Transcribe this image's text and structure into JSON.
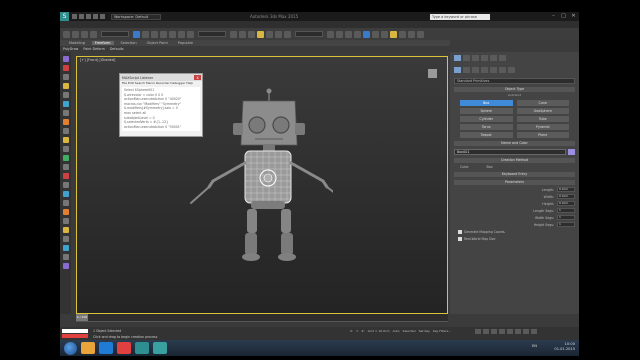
{
  "titlebar": {
    "logo": "S",
    "workspace": "Workspace: Default",
    "app_title": "Autodesk 3ds Max 2015",
    "search_placeholder": "Type a keyword or phrase",
    "min": "–",
    "max": "□",
    "close": "✕"
  },
  "ribbon": {
    "tabs": [
      "Modeling",
      "Freeform",
      "Selection",
      "Object Paint",
      "Populate"
    ],
    "active_tab": "Freeform",
    "subtabs": [
      "PolyDraw",
      "Paint Deform",
      "Defaults"
    ]
  },
  "viewport": {
    "label": "[+] [Front] [Shaded]"
  },
  "listener": {
    "title": "MAXScript Listener",
    "menu": "File  Edit  Search  Macro Recorder  Debugger  Help",
    "close": "x",
    "lines": [
      "Select $Sphere001",
      "$.wirecolor = color 0 0 0",
      "actionMan.executeAction 0 \"40020\"",
      "macros.run \"Modifiers\" \"Symmetry\"",
      "$.modifiers[#Symmetry].axis = 0",
      "max select all",
      "subobjectLevel = 0",
      "$.selectedVerts = #{1..12}",
      "actionMan.executeAction 0 \"50001\"",
      "modPanel.setCurrentObject $",
      "macros.run \"Edit Poly\" \"Attach\"",
      "select $Box001"
    ]
  },
  "command_panel": {
    "category": "Standard Primitives",
    "object_type": "Object Type",
    "autogrid": "AutoGrid",
    "buttons": [
      "Box",
      "Cone",
      "Sphere",
      "GeoSphere",
      "Cylinder",
      "Tube",
      "Torus",
      "Pyramid",
      "Teapot",
      "Plane"
    ],
    "active_button": "Box",
    "name_color": "Name and Color",
    "name_value": "Box001",
    "creation_method": "Creation Method",
    "cube": "Cube",
    "box": "Box",
    "keyboard_entry": "Keyboard Entry",
    "parameters": "Parameters",
    "params": [
      {
        "label": "Length:",
        "value": "0.0cm"
      },
      {
        "label": "Width:",
        "value": "0.0cm"
      },
      {
        "label": "Height:",
        "value": "0.0cm"
      },
      {
        "label": "Length Segs:",
        "value": "1"
      },
      {
        "label": "Width Segs:",
        "value": "1"
      },
      {
        "label": "Height Segs:",
        "value": "1"
      }
    ],
    "gen_mapping": "Generate Mapping Coords.",
    "real_world": "Real-World Map Size"
  },
  "timeline": {
    "slider": "0 / 100"
  },
  "status": {
    "line1": "1 Object Selected",
    "line2": "Click and drag to begin creation process",
    "coords": [
      "X:",
      "Y:",
      "Z:",
      "Grid = 10.0cm",
      "Auto",
      "Selected",
      "Set Key",
      "Key Filters..."
    ]
  },
  "taskbar": {
    "lang": "EN",
    "time": "10:00",
    "date": "01.01.2015",
    "items_colors": [
      "#e8a43a",
      "#1f7bd4",
      "#e04040",
      "#2d8f8f",
      "#39a0a0"
    ]
  }
}
